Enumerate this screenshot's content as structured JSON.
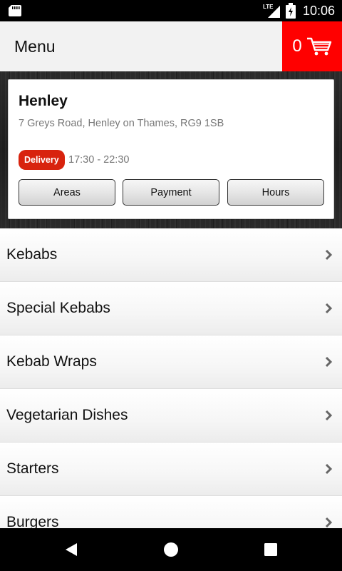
{
  "status_bar": {
    "time": "10:06",
    "network": "LTE",
    "icons": [
      "sd-card-icon",
      "signal-icon",
      "battery-icon"
    ]
  },
  "app_bar": {
    "title": "Menu",
    "cart_count": "0",
    "cart_color": "#ff0000"
  },
  "store": {
    "name": "Henley",
    "address": "7 Greys Road, Henley on Thames, RG9 1SB",
    "delivery_badge": "Delivery",
    "delivery_badge_color": "#d8230e",
    "hours": "17:30 - 22:30",
    "buttons": {
      "areas": "Areas",
      "payment": "Payment",
      "hours": "Hours"
    }
  },
  "menu": {
    "items": [
      {
        "label": "Kebabs"
      },
      {
        "label": "Special Kebabs"
      },
      {
        "label": "Kebab Wraps"
      },
      {
        "label": "Vegetarian Dishes"
      },
      {
        "label": "Starters"
      },
      {
        "label": "Burgers"
      }
    ]
  },
  "nav_bar": {
    "icons": [
      "back-icon",
      "home-icon",
      "recents-icon"
    ]
  }
}
